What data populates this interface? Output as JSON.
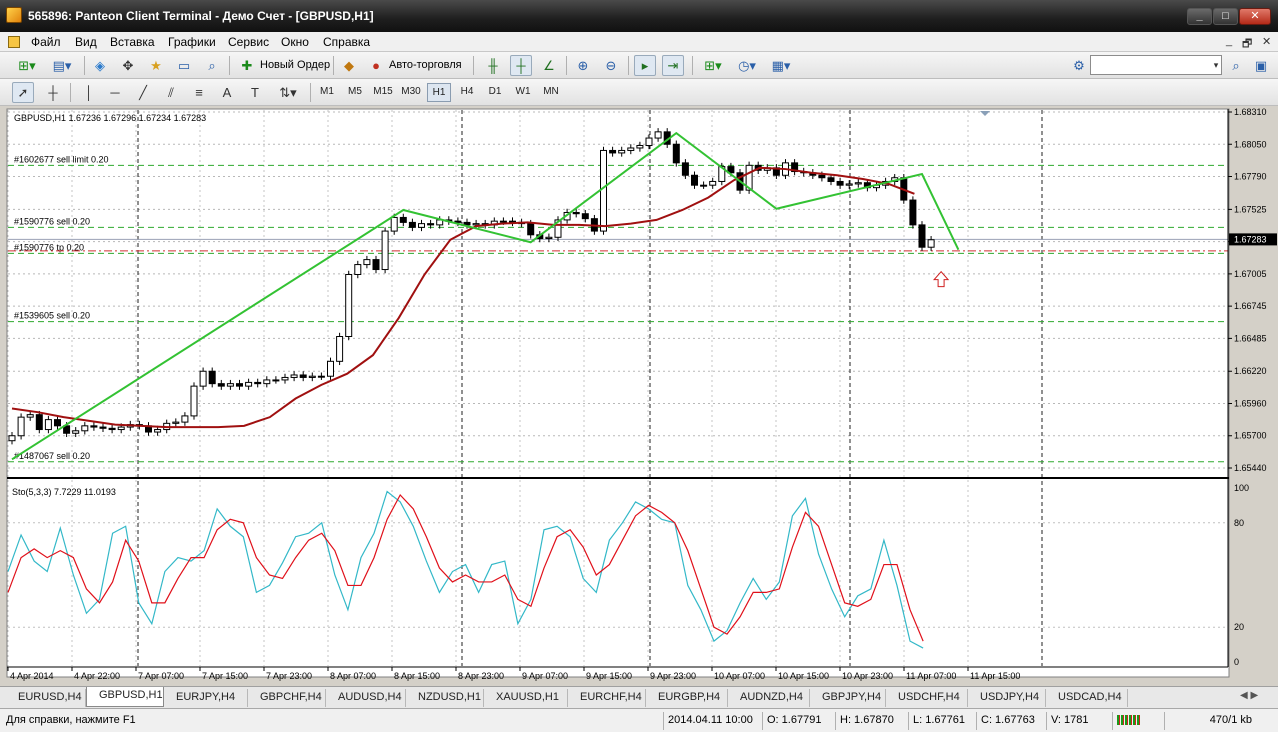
{
  "window": {
    "title": "565896: Panteon Client Terminal - Демо Счет - [GBPUSD,H1]",
    "controls": [
      "_",
      "□",
      "✕"
    ]
  },
  "menu": {
    "items": [
      "Файл",
      "Вид",
      "Вставка",
      "Графики",
      "Сервис",
      "Окно",
      "Справка"
    ],
    "mdi_controls": [
      "_",
      "🗗",
      "✕"
    ]
  },
  "toolbar1": {
    "new_order_label": "Новый Ордер",
    "auto_trading_label": "Авто-торговля"
  },
  "toolbar2": {
    "timeframes": [
      "M1",
      "M5",
      "M15",
      "M30",
      "H1",
      "H4",
      "D1",
      "W1",
      "MN"
    ],
    "active_timeframe": "H1"
  },
  "chart": {
    "header": "GBPUSD,H1  1.67236 1.67296 1.67234 1.67283",
    "current_price": "1.67283",
    "order_labels": [
      "#1602677 sell limit 0.20",
      "#1590776 sell 0.20",
      "#1590776 tp 0.20",
      "#1539605 sell 0.20",
      "#1487067 sell 0.20"
    ],
    "order_levels": [
      1.6788,
      1.6738,
      1.6717,
      1.6662,
      1.6549
    ],
    "tp_level": 1.6719,
    "indicator_label": "Sto(5,3,3) 7.7229 11.0193",
    "price_ticks": [
      "1.68310",
      "1.68050",
      "1.67790",
      "1.67525",
      "1.67265",
      "1.67005",
      "1.66745",
      "1.66485",
      "1.66220",
      "1.65960",
      "1.65700",
      "1.65440"
    ],
    "sto_ticks": [
      "100",
      "80",
      "20",
      "0"
    ],
    "time_ticks": [
      "4 Apr 2014",
      "4 Apr 22:00",
      "7 Apr 07:00",
      "7 Apr 15:00",
      "7 Apr 23:00",
      "8 Apr 07:00",
      "8 Apr 15:00",
      "8 Apr 23:00",
      "9 Apr 07:00",
      "9 Apr 15:00",
      "9 Apr 23:00",
      "10 Apr 07:00",
      "10 Apr 15:00",
      "10 Apr 23:00",
      "11 Apr 07:00",
      "11 Apr 15:00"
    ],
    "colors": {
      "zigzag": "#33c233",
      "moving_average": "#a01010",
      "stoch_main": "#33b8c8",
      "stoch_signal": "#e0101a",
      "order_line": "#2eaa2e",
      "tp_line": "#d03030"
    }
  },
  "chart_data": {
    "type": "candlestick",
    "symbol": "GBPUSD",
    "timeframe": "H1",
    "ylim": [
      1.6544,
      1.6831
    ],
    "closes": [
      1.657,
      1.6585,
      1.6587,
      1.6575,
      1.6583,
      1.6578,
      1.6572,
      1.6574,
      1.6578,
      1.6577,
      1.6576,
      1.6575,
      1.6577,
      1.6579,
      1.6578,
      1.6573,
      1.6575,
      1.658,
      1.6581,
      1.6586,
      1.661,
      1.6622,
      1.6612,
      1.661,
      1.6612,
      1.661,
      1.6613,
      1.6612,
      1.6615,
      1.6615,
      1.6617,
      1.6619,
      1.6617,
      1.6618,
      1.6618,
      1.663,
      1.665,
      1.67,
      1.6708,
      1.6712,
      1.6704,
      1.6735,
      1.6746,
      1.6742,
      1.6738,
      1.6741,
      1.674,
      1.6744,
      1.6743,
      1.6742,
      1.674,
      1.6741,
      1.674,
      1.6743,
      1.6743,
      1.6742,
      1.6741,
      1.6732,
      1.6729,
      1.673,
      1.6744,
      1.675,
      1.6749,
      1.6745,
      1.6735,
      1.68,
      1.6798,
      1.68,
      1.6802,
      1.6804,
      1.681,
      1.6815,
      1.6805,
      1.679,
      1.678,
      1.6772,
      1.6772,
      1.6775,
      1.6787,
      1.6782,
      1.6768,
      1.6788,
      1.6784,
      1.6786,
      1.678,
      1.679,
      1.6783,
      1.6782,
      1.678,
      1.6778,
      1.6775,
      1.6772,
      1.6773,
      1.6774,
      1.677,
      1.6772,
      1.6775,
      1.6778,
      1.676,
      1.674,
      1.6722,
      1.6728
    ],
    "zigzag": [
      [
        0,
        1.6551
      ],
      [
        43,
        1.6752
      ],
      [
        57,
        1.6726
      ],
      [
        73,
        1.6814
      ],
      [
        84,
        1.6753
      ],
      [
        100,
        1.6781
      ],
      [
        104,
        1.672
      ]
    ],
    "moving_average": [
      1.6592,
      1.6589,
      1.6585,
      1.6582,
      1.6579,
      1.6578,
      1.6577,
      1.6577,
      1.6577,
      1.6578,
      1.6585,
      1.66,
      1.6611,
      1.662,
      1.6635,
      1.6665,
      1.67,
      1.6728,
      1.6739,
      1.6741,
      1.6742,
      1.674,
      1.674,
      1.6739,
      1.6741,
      1.6744,
      1.6752,
      1.6762,
      1.6776,
      1.6786,
      1.6785,
      1.6782,
      1.678,
      1.6777,
      1.6773,
      1.6765
    ],
    "stoch_main": [
      52,
      73,
      58,
      52,
      77,
      50,
      28,
      36,
      74,
      78,
      34,
      22,
      52,
      60,
      58,
      64,
      88,
      78,
      72,
      40,
      44,
      57,
      72,
      74,
      80,
      50,
      30,
      60,
      74,
      98,
      92,
      78,
      58,
      40,
      52,
      56,
      40,
      56,
      58,
      22,
      36,
      76,
      78,
      72,
      48,
      40,
      70,
      80,
      92,
      88,
      82,
      80,
      44,
      30,
      12,
      18,
      34,
      48,
      36,
      46,
      84,
      94,
      62,
      42,
      26,
      38,
      42,
      70,
      44,
      12,
      8
    ],
    "stoch_signal": [
      40,
      60,
      65,
      60,
      64,
      60,
      42,
      34,
      46,
      70,
      58,
      34,
      34,
      48,
      60,
      60,
      76,
      82,
      80,
      60,
      50,
      48,
      60,
      70,
      74,
      64,
      44,
      44,
      60,
      82,
      96,
      88,
      72,
      54,
      46,
      50,
      46,
      46,
      50,
      36,
      32,
      54,
      72,
      76,
      66,
      50,
      56,
      70,
      84,
      90,
      86,
      80,
      64,
      42,
      20,
      16,
      26,
      40,
      40,
      42,
      66,
      86,
      78,
      56,
      34,
      32,
      36,
      56,
      56,
      30,
      12
    ]
  },
  "tabs": {
    "items": [
      "EURUSD,H4",
      "GBPUSD,H1",
      "EURJPY,H4",
      "GBPCHF,H4",
      "AUDUSD,H4",
      "NZDUSD,H1",
      "XAUUSD,H1",
      "EURCHF,H4",
      "EURGBP,H4",
      "AUDNZD,H4",
      "GBPJPY,H4",
      "USDCHF,H4",
      "USDJPY,H4",
      "USDCAD,H4"
    ],
    "active": "GBPUSD,H1"
  },
  "status": {
    "help": "Для справки, нажмите F1",
    "datetime": "2014.04.11 10:00",
    "open": "O: 1.67791",
    "high": "H: 1.67870",
    "low": "L: 1.67761",
    "close": "C: 1.67763",
    "volume": "V: 1781",
    "traffic": "470/1 kb"
  }
}
